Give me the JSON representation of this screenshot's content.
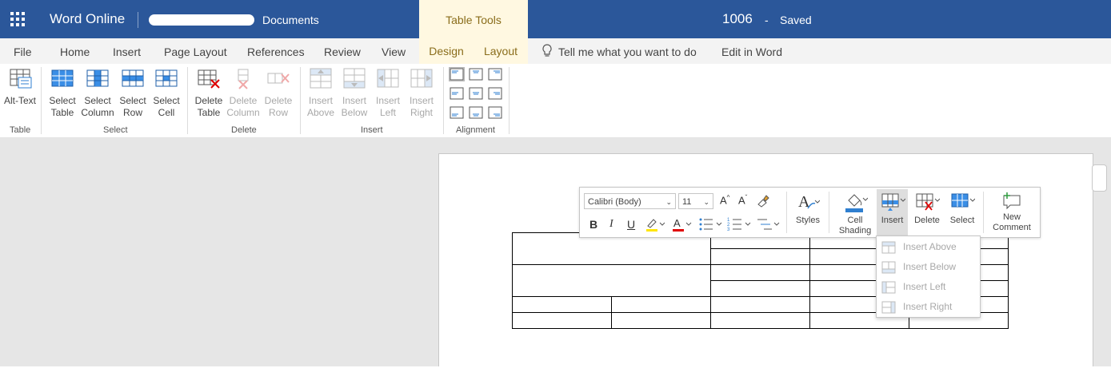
{
  "titlebar": {
    "app_name": "Word Online",
    "breadcrumb": "Documents",
    "context_group": "Table Tools",
    "doc_name": "1006",
    "separator": "-",
    "status": "Saved",
    "bg_color": "#2b579a"
  },
  "tabs": {
    "file": "File",
    "home": "Home",
    "insert": "Insert",
    "page_layout": "Page Layout",
    "references": "References",
    "review": "Review",
    "view": "View",
    "design": "Design",
    "layout": "Layout",
    "tell_me": "Tell me what you want to do",
    "edit_in_word": "Edit in Word",
    "active": "Layout"
  },
  "ribbon": {
    "table_group": {
      "label": "Table",
      "alt_text": "Alt-Text"
    },
    "select_group": {
      "label": "Select",
      "select_table": "Select\nTable",
      "select_column": "Select\nColumn",
      "select_row": "Select\nRow",
      "select_cell": "Select\nCell"
    },
    "delete_group": {
      "label": "Delete",
      "delete_table": "Delete\nTable",
      "delete_column": "Delete\nColumn",
      "delete_row": "Delete\nRow"
    },
    "insert_group": {
      "label": "Insert",
      "insert_above": "Insert\nAbove",
      "insert_below": "Insert\nBelow",
      "insert_left": "Insert\nLeft",
      "insert_right": "Insert\nRight"
    },
    "alignment_group": {
      "label": "Alignment"
    }
  },
  "floating_toolbar": {
    "font_name": "Calibri (Body)",
    "font_size": "11",
    "bold": "B",
    "italic": "I",
    "underline": "U",
    "styles": "Styles",
    "cell_shading": "Cell\nShading",
    "insert": "Insert",
    "delete": "Delete",
    "select": "Select",
    "new_comment": "New\nComment"
  },
  "insert_dropdown": {
    "items": [
      "Insert Above",
      "Insert Below",
      "Insert Left",
      "Insert Right"
    ]
  },
  "colors": {
    "accent": "#2b579a",
    "context_tab_bg": "#fff8e1",
    "context_tab_text": "#8a6d1b",
    "highlight_yellow": "#ffe600",
    "font_color_red": "#e00000",
    "shading_blue": "#2f7fd0"
  }
}
